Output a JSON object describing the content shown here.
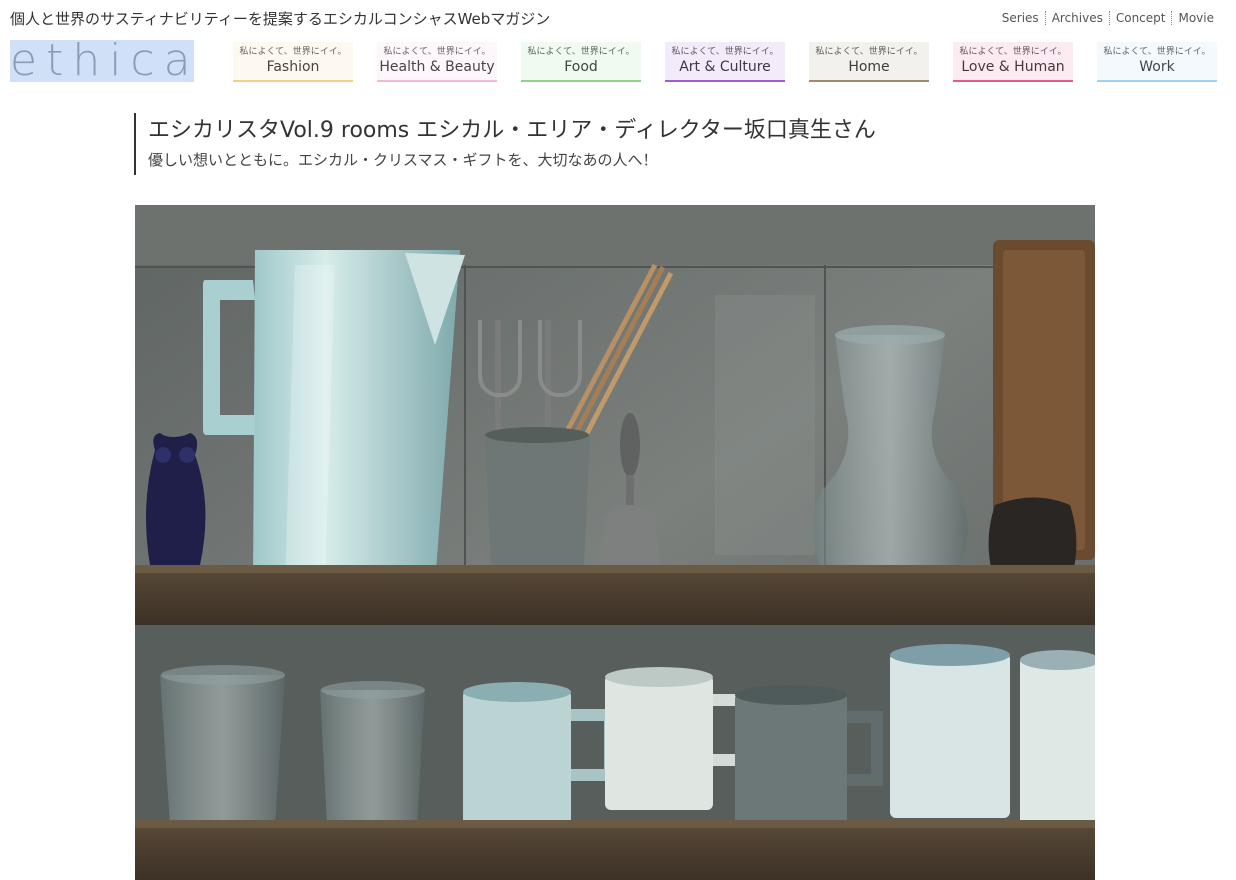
{
  "header": {
    "tagline": "個人と世界のサスティナビリティーを提案するエシカルコンシャスWebマガジン",
    "logo_text": "ethica",
    "top_links": [
      "Series",
      "Archives",
      "Concept",
      "Movie"
    ]
  },
  "categories": [
    {
      "sub": "私によくて、世界にイイ。",
      "label": "Fashion",
      "color": "#f2d08a"
    },
    {
      "sub": "私によくて、世界にイイ。",
      "label": "Health & Beauty",
      "color": "#f2b8d6"
    },
    {
      "sub": "私によくて、世界にイイ。",
      "label": "Food",
      "color": "#8fd38a"
    },
    {
      "sub": "私によくて、世界にイイ。",
      "label": "Art & Culture",
      "color": "#a45ad6"
    },
    {
      "sub": "私によくて、世界にイイ。",
      "label": "Home",
      "color": "#a08a6e"
    },
    {
      "sub": "私によくて、世界にイイ。",
      "label": "Love & Human",
      "color": "#e55a8f"
    },
    {
      "sub": "私によくて、世界にイイ。",
      "label": "Work",
      "color": "#9fd1f2"
    }
  ],
  "article": {
    "title": "エシカリスタVol.9 rooms エシカル・エリア・ディレクター坂口真生さん",
    "subtitle": "優しい想いとともに。エシカル・クリスマス・ギフトを、大切なあの人へ！"
  }
}
